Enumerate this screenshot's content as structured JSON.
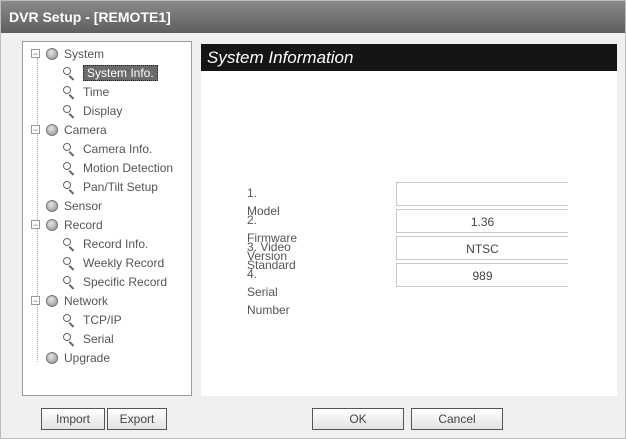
{
  "window": {
    "title": "DVR Setup - [REMOTE1]"
  },
  "sidebar": {
    "items": [
      {
        "label": "System",
        "level": 0,
        "toggle": "−",
        "icon": "gear-icon"
      },
      {
        "label": "System Info.",
        "level": 1,
        "icon": "magnifier-icon",
        "selected": true
      },
      {
        "label": "Time",
        "level": 1,
        "icon": "magnifier-icon"
      },
      {
        "label": "Display",
        "level": 1,
        "icon": "magnifier-icon"
      },
      {
        "label": "Camera",
        "level": 0,
        "toggle": "−",
        "icon": "gear-icon"
      },
      {
        "label": "Camera Info.",
        "level": 1,
        "icon": "magnifier-icon"
      },
      {
        "label": "Motion Detection",
        "level": 1,
        "icon": "magnifier-icon"
      },
      {
        "label": "Pan/Tilt Setup",
        "level": 1,
        "icon": "magnifier-icon"
      },
      {
        "label": "Sensor",
        "level": 0,
        "icon": "gear-icon"
      },
      {
        "label": "Record",
        "level": 0,
        "toggle": "−",
        "icon": "gear-icon"
      },
      {
        "label": "Record Info.",
        "level": 1,
        "icon": "magnifier-icon"
      },
      {
        "label": "Weekly Record",
        "level": 1,
        "icon": "magnifier-icon"
      },
      {
        "label": "Specific Record",
        "level": 1,
        "icon": "magnifier-icon"
      },
      {
        "label": "Network",
        "level": 0,
        "toggle": "−",
        "icon": "gear-icon"
      },
      {
        "label": "TCP/IP",
        "level": 1,
        "icon": "magnifier-icon"
      },
      {
        "label": "Serial",
        "level": 1,
        "icon": "magnifier-icon"
      },
      {
        "label": "Upgrade",
        "level": 0,
        "icon": "gear-icon"
      }
    ]
  },
  "main": {
    "title": "System Information",
    "fields": [
      {
        "label": "1. Model",
        "value": ""
      },
      {
        "label": "2. Firmware Version",
        "value": "1.36"
      },
      {
        "label": "3. Video Standard",
        "value": "NTSC"
      },
      {
        "label": "4. Serial Number",
        "value": "989"
      }
    ]
  },
  "footer": {
    "import_label": "Import",
    "export_label": "Export",
    "ok_label": "OK",
    "cancel_label": "Cancel"
  }
}
